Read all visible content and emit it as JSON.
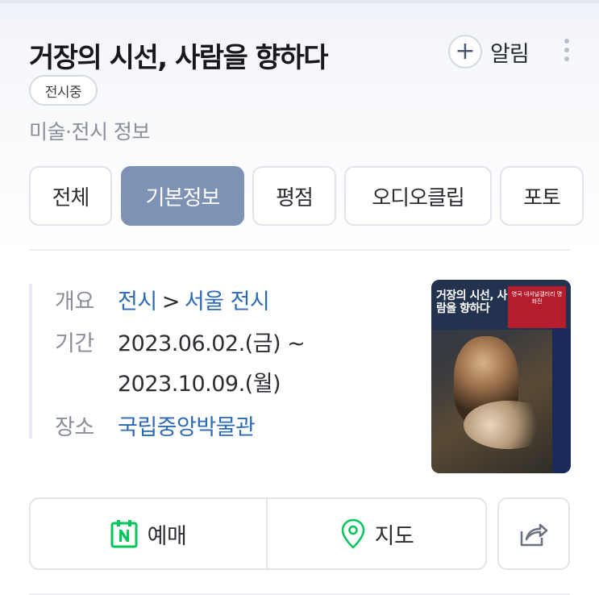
{
  "header": {
    "title": "거장의 시선, 사람을 향하다",
    "alarm_label": "알림",
    "status_badge": "전시중",
    "category": "미술·전시 정보"
  },
  "tabs": [
    {
      "label": "전체",
      "active": false
    },
    {
      "label": "기본정보",
      "active": true
    },
    {
      "label": "평점",
      "active": false
    },
    {
      "label": "오디오클립",
      "active": false
    },
    {
      "label": "포토",
      "active": false
    }
  ],
  "info": {
    "overview_label": "개요",
    "overview_category": "전시",
    "overview_separator": ">",
    "overview_region": "서울 전시",
    "period_label": "기간",
    "period_start": "2023.06.02.(금) ~",
    "period_end": "2023.10.09.(월)",
    "venue_label": "장소",
    "venue": "국립중앙박물관"
  },
  "poster": {
    "title": "거장의 시선, 사람을 향하다",
    "subtitle": "영국 내셔널갤러리 명화전"
  },
  "actions": {
    "booking_label": "예매",
    "map_label": "지도"
  },
  "colors": {
    "accent_tab": "#7e92b6",
    "link": "#2c6ab8",
    "naver_green": "#03c75a"
  },
  "icons": [
    "plus-icon",
    "more-vertical-icon",
    "naver-calendar-icon",
    "map-pin-icon",
    "share-icon"
  ]
}
